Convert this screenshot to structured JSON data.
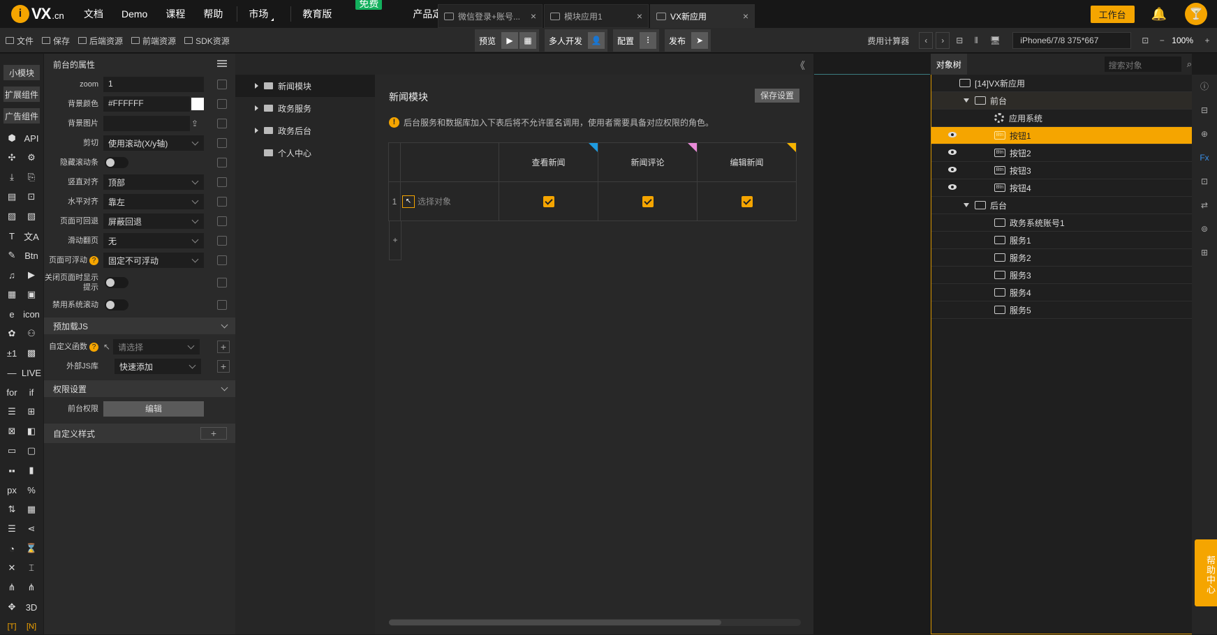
{
  "topnav": {
    "logo_icon": "i",
    "logo_text": "VX",
    "logo_suffix": ".cn",
    "menu": [
      "文档",
      "Demo",
      "课程",
      "帮助"
    ],
    "market": "市场",
    "edu": "教育版",
    "free_badge": "免费",
    "pricing": "产品定价",
    "workbench": "工作台",
    "bell_icon": "bell-icon",
    "avatar_icon": "🍸"
  },
  "tabs": [
    {
      "label": "微信登录+账号...",
      "close": "×"
    },
    {
      "label": "模块应用1",
      "close": "×"
    },
    {
      "label": "VX新应用",
      "close": "×"
    }
  ],
  "toolbar": {
    "items": [
      "文件",
      "保存",
      "后端资源",
      "前端资源",
      "SDK资源"
    ],
    "preview": "预览",
    "multidev": "多人开发",
    "config": "配置",
    "publish": "发布",
    "fee": "费用计算器",
    "prev": "‹",
    "next": "›",
    "device": "iPhone6/7/8 375*667",
    "zoom": "100%",
    "zoom_out": "−",
    "zoom_in": "+"
  },
  "leftbar": {
    "buttons": [
      "小模块",
      "扩展组件",
      "广告组件"
    ],
    "icons": [
      "⬢",
      "API",
      "✣",
      "⚙",
      "⤓",
      "⎘",
      "▤",
      "⊡",
      "▨",
      "▧",
      "T",
      "文A",
      "✎",
      "Btn",
      "♫",
      "▶",
      "▦",
      "▣",
      "e",
      "icon",
      "✿",
      "⚇",
      "±1",
      "▩",
      "—",
      "LIVE",
      "for",
      "if",
      "☰",
      "⊞",
      "⊠",
      "◧",
      "▭",
      "▢",
      "▪▪",
      "▮",
      "px",
      "%",
      "⇅",
      "▦",
      "☰",
      "⋖",
      "◔",
      "⌛",
      "✕",
      "⌶",
      "⋔",
      "⋔",
      "✥",
      "3D",
      "[T]",
      "[N]"
    ]
  },
  "props": {
    "title": "前台的属性",
    "rows": [
      {
        "label": "zoom",
        "value": "1"
      },
      {
        "label": "背景颜色",
        "value": "#FFFFFF"
      },
      {
        "label": "背景图片",
        "value": ""
      },
      {
        "label": "剪切",
        "value": "使用滚动(X/y轴)"
      },
      {
        "label": "隐藏滚动条",
        "value": ""
      },
      {
        "label": "竖直对齐",
        "value": "顶部"
      },
      {
        "label": "水平对齐",
        "value": "靠左"
      },
      {
        "label": "页面可回退",
        "value": "屏蔽回退"
      },
      {
        "label": "滑动翻页",
        "value": "无"
      },
      {
        "label": "页面可浮动",
        "value": "固定不可浮动"
      },
      {
        "label": "关闭页面时显示提示",
        "value": ""
      },
      {
        "label": "禁用系统滚动",
        "value": ""
      }
    ],
    "q": "?",
    "sec_js": "预加载JS",
    "custom_fn": "自定义函数",
    "custom_fn_value": "请选择",
    "ext_lib": "外部JS库",
    "ext_lib_value": "快速添加",
    "sec_perm": "权限设置",
    "front_perm": "前台权限",
    "edit": "编辑",
    "custom_style": "自定义样式",
    "plus": "+"
  },
  "tree": {
    "collapse": "《",
    "items": [
      "新闻模块",
      "政务服务",
      "政务后台",
      "个人中心"
    ]
  },
  "main": {
    "title": "新闻模块",
    "save": "保存设置",
    "warn_icon": "!",
    "warning": "后台服务和数据库加入下表后将不允许匿名调用，使用者需要具备对应权限的角色。",
    "columns": [
      "查看新闻",
      "新闻评论",
      "编辑新闻"
    ],
    "tri_colors": [
      "#1e9be0",
      "#e98ad8",
      "#f5b300"
    ],
    "row_num": "1",
    "row_obj": "选择对象",
    "pick_icon": "↖",
    "add": "+"
  },
  "right": {
    "tab": "对象树",
    "search": "搜索对象",
    "search_icon": "🔍",
    "nodes": [
      "[14]VX新应用",
      "前台",
      "应用系统",
      "按钮1",
      "按钮2",
      "按钮3",
      "按钮4",
      "后台",
      "政务系统账号1",
      "服务1",
      "服务2",
      "服务3",
      "服务4",
      "服务5"
    ],
    "btn_tag": "Btn",
    "side_icons": [
      "ⓘ",
      "⊟",
      "⊕",
      "Fx",
      "⊡",
      "⇄",
      "⊚",
      "⊞"
    ],
    "help": "帮助中心",
    "help_q": "?"
  }
}
